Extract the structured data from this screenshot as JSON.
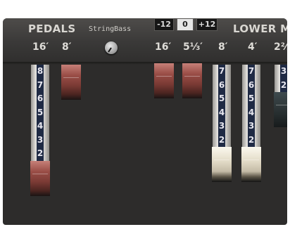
{
  "header": {
    "pedals_label": "PEDALS",
    "stringbass_label": "StringBass",
    "lower_label": "LOWER M",
    "transpose": {
      "minus": "-12",
      "zero": "0",
      "plus": "+12"
    },
    "footages": [
      "16′",
      "8′",
      "16′",
      "5⅓′",
      "8′",
      "4′",
      "2⅔′"
    ]
  },
  "drawbar_numbers": [
    "1",
    "2",
    "3",
    "4",
    "5",
    "6",
    "7",
    "8"
  ],
  "drawbars": [
    {
      "id": "pedal-16",
      "value": 8,
      "color": "red"
    },
    {
      "id": "pedal-8",
      "value": 1,
      "color": "red"
    },
    {
      "id": "lower-16",
      "value": 0,
      "color": "red"
    },
    {
      "id": "lower-5-1-3",
      "value": 0,
      "color": "red"
    },
    {
      "id": "lower-8",
      "value": 7,
      "color": "cream"
    },
    {
      "id": "lower-4",
      "value": 7,
      "color": "cream"
    },
    {
      "id": "lower-2-2-3",
      "value": 3,
      "color": "dark"
    }
  ]
}
